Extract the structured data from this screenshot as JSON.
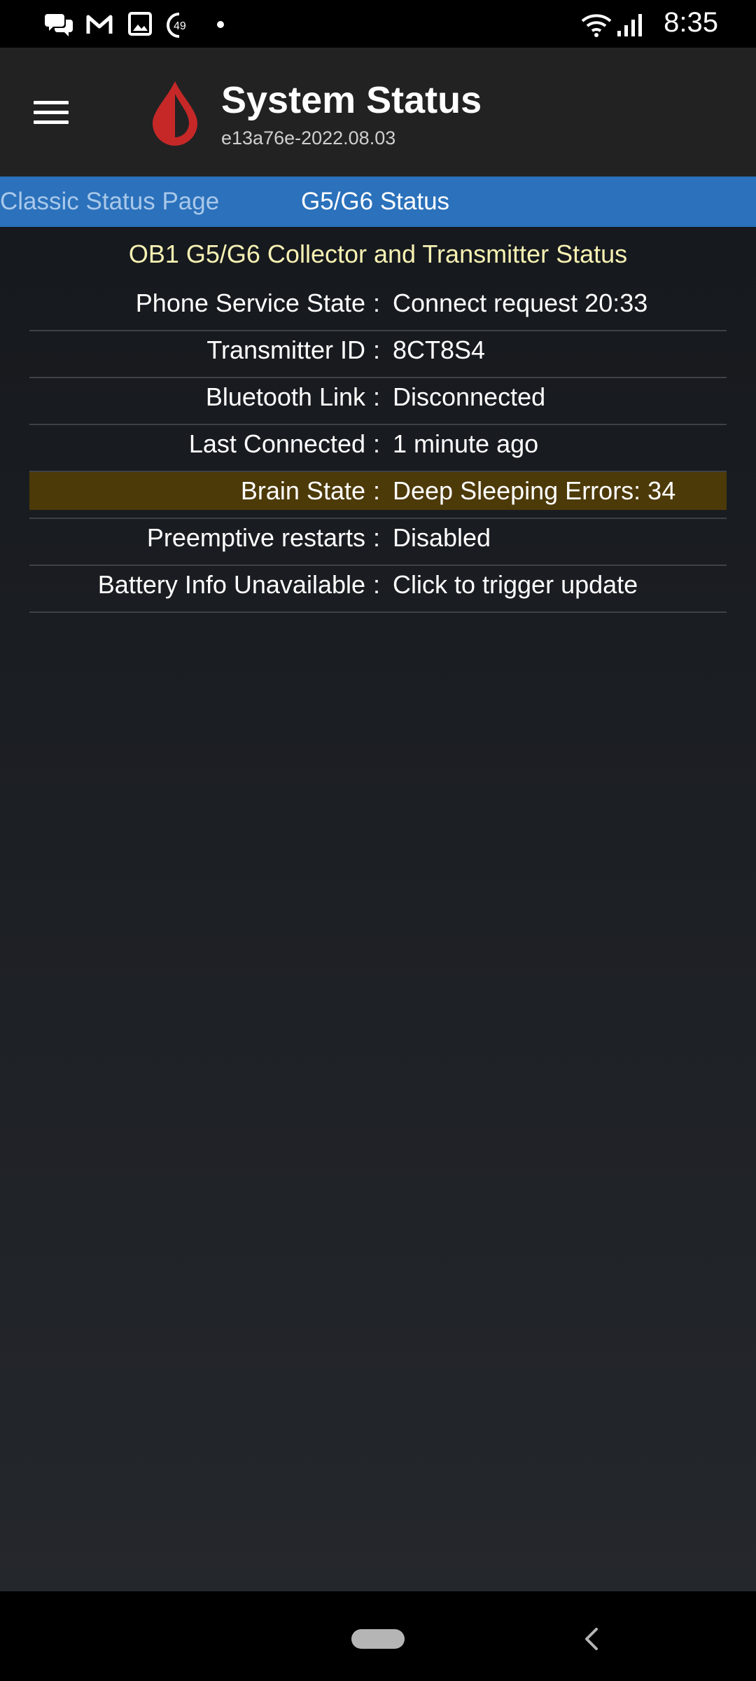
{
  "status_bar": {
    "time": "8:35",
    "notification_icons": [
      "chat-bubbles-icon",
      "gmail-icon",
      "gallery-icon",
      "badge-49-icon",
      "dot-icon"
    ],
    "badge_number": "49",
    "system_icons": [
      "wifi-icon",
      "cellular-signal-icon"
    ]
  },
  "app_bar": {
    "title": "System Status",
    "subtitle": "e13a76e-2022.08.03",
    "logo_color": "#c62828"
  },
  "tabs": [
    {
      "label": "Classic Status Page",
      "selected": false
    },
    {
      "label": "G5/G6 Status",
      "selected": true
    }
  ],
  "content": {
    "heading": "OB1 G5/G6 Collector and Transmitter Status",
    "separator": ":",
    "rows": [
      {
        "label": "Phone Service State",
        "value": "Connect request 20:33",
        "highlight": false
      },
      {
        "label": "Transmitter ID",
        "value": "8CT8S4",
        "highlight": false
      },
      {
        "label": "Bluetooth Link",
        "value": "Disconnected",
        "highlight": false
      },
      {
        "label": "Last Connected",
        "value": "1 minute ago",
        "highlight": false
      },
      {
        "label": "Brain State",
        "value": "Deep Sleeping Errors: 34",
        "highlight": true
      },
      {
        "label": "Preemptive restarts",
        "value": "Disabled",
        "highlight": false
      },
      {
        "label": "Battery Info Unavailable",
        "value": "Click to trigger update",
        "highlight": false
      }
    ]
  },
  "colors": {
    "tab_strip": "#2b71bb",
    "heading": "#f7f1b3",
    "highlight_row": "#4d3a09",
    "app_bar": "#222223"
  }
}
